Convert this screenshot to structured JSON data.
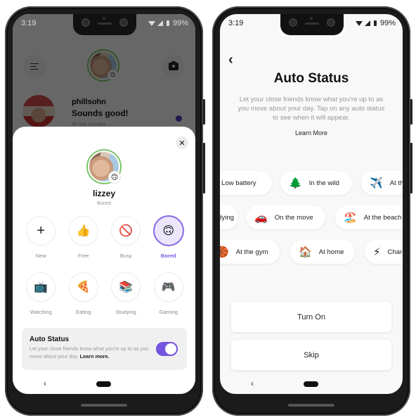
{
  "status_bar": {
    "time": "3:19",
    "battery": "99%"
  },
  "left": {
    "background_app": {
      "menu_icon": "hamburger-icon",
      "camera_icon": "camera-icon",
      "conversation": {
        "name": "phillsohn",
        "message": "Sounds good!",
        "status": "At the movies",
        "unread_color": "#4b3bb5"
      }
    },
    "sheet": {
      "close_label": "✕",
      "user_name": "lizzey",
      "user_status": "Bored",
      "badge_emoji": "🙃",
      "statuses": [
        {
          "label": "New",
          "emoji": "+",
          "selected": false
        },
        {
          "label": "Free",
          "emoji": "👍",
          "selected": false
        },
        {
          "label": "Busy",
          "emoji": "🚫",
          "selected": false
        },
        {
          "label": "Bored",
          "emoji": "🙃",
          "selected": true
        },
        {
          "label": "Watching",
          "emoji": "📺",
          "selected": false
        },
        {
          "label": "Eating",
          "emoji": "🍕",
          "selected": false
        },
        {
          "label": "Studying",
          "emoji": "📚",
          "selected": false
        },
        {
          "label": "Gaming",
          "emoji": "🎮",
          "selected": false
        }
      ],
      "auto_status": {
        "title": "Auto Status",
        "description": "Let your close friends know what you're up to as you move about your day.",
        "learn_more": "Learn more.",
        "enabled": true,
        "toggle_color": "#7552e0"
      }
    }
  },
  "right": {
    "back_label": "‹",
    "title": "Auto Status",
    "description": "Let your close friends know what you're up to as you move about your day. Tap on any auto status to see when it will appear.",
    "learn_more": "Learn More",
    "chip_rows": [
      [
        {
          "label": "Low battery",
          "emoji": ""
        },
        {
          "label": "In the wild",
          "emoji": "🌲"
        },
        {
          "label": "At the airport",
          "emoji": "✈️"
        }
      ],
      [
        {
          "label": "Studying",
          "emoji": ""
        },
        {
          "label": "On the move",
          "emoji": "🚗"
        },
        {
          "label": "At the beach",
          "emoji": "🏖️"
        }
      ],
      [
        {
          "label": "At the gym",
          "emoji": "🏀"
        },
        {
          "label": "At home",
          "emoji": "🏠"
        },
        {
          "label": "Charging",
          "emoji": "⚡"
        }
      ]
    ],
    "turn_on_label": "Turn On",
    "skip_label": "Skip"
  },
  "nav": {
    "back": "‹"
  }
}
